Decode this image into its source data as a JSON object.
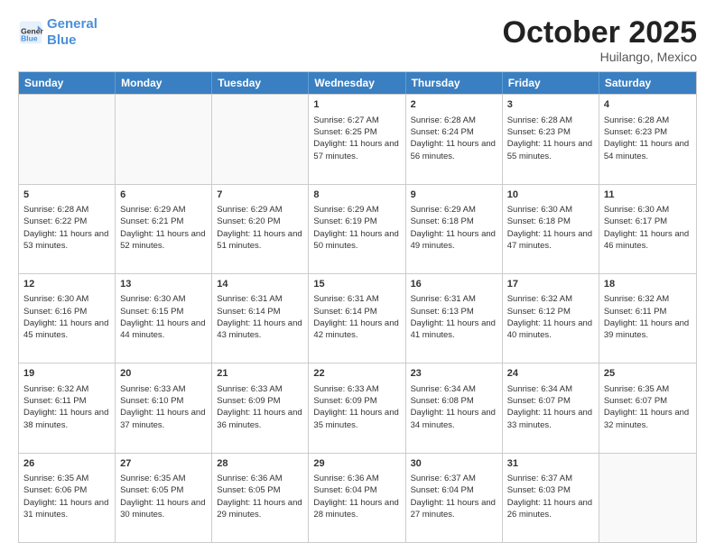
{
  "logo": {
    "line1": "General",
    "line2": "Blue"
  },
  "title": "October 2025",
  "location": "Huilango, Mexico",
  "days_of_week": [
    "Sunday",
    "Monday",
    "Tuesday",
    "Wednesday",
    "Thursday",
    "Friday",
    "Saturday"
  ],
  "weeks": [
    [
      {
        "day": "",
        "empty": true
      },
      {
        "day": "",
        "empty": true
      },
      {
        "day": "",
        "empty": true
      },
      {
        "day": "1",
        "sunrise": "6:27 AM",
        "sunset": "6:25 PM",
        "daylight": "11 hours and 57 minutes."
      },
      {
        "day": "2",
        "sunrise": "6:28 AM",
        "sunset": "6:24 PM",
        "daylight": "11 hours and 56 minutes."
      },
      {
        "day": "3",
        "sunrise": "6:28 AM",
        "sunset": "6:23 PM",
        "daylight": "11 hours and 55 minutes."
      },
      {
        "day": "4",
        "sunrise": "6:28 AM",
        "sunset": "6:23 PM",
        "daylight": "11 hours and 54 minutes."
      }
    ],
    [
      {
        "day": "5",
        "sunrise": "6:28 AM",
        "sunset": "6:22 PM",
        "daylight": "11 hours and 53 minutes."
      },
      {
        "day": "6",
        "sunrise": "6:29 AM",
        "sunset": "6:21 PM",
        "daylight": "11 hours and 52 minutes."
      },
      {
        "day": "7",
        "sunrise": "6:29 AM",
        "sunset": "6:20 PM",
        "daylight": "11 hours and 51 minutes."
      },
      {
        "day": "8",
        "sunrise": "6:29 AM",
        "sunset": "6:19 PM",
        "daylight": "11 hours and 50 minutes."
      },
      {
        "day": "9",
        "sunrise": "6:29 AM",
        "sunset": "6:18 PM",
        "daylight": "11 hours and 49 minutes."
      },
      {
        "day": "10",
        "sunrise": "6:30 AM",
        "sunset": "6:18 PM",
        "daylight": "11 hours and 47 minutes."
      },
      {
        "day": "11",
        "sunrise": "6:30 AM",
        "sunset": "6:17 PM",
        "daylight": "11 hours and 46 minutes."
      }
    ],
    [
      {
        "day": "12",
        "sunrise": "6:30 AM",
        "sunset": "6:16 PM",
        "daylight": "11 hours and 45 minutes."
      },
      {
        "day": "13",
        "sunrise": "6:30 AM",
        "sunset": "6:15 PM",
        "daylight": "11 hours and 44 minutes."
      },
      {
        "day": "14",
        "sunrise": "6:31 AM",
        "sunset": "6:14 PM",
        "daylight": "11 hours and 43 minutes."
      },
      {
        "day": "15",
        "sunrise": "6:31 AM",
        "sunset": "6:14 PM",
        "daylight": "11 hours and 42 minutes."
      },
      {
        "day": "16",
        "sunrise": "6:31 AM",
        "sunset": "6:13 PM",
        "daylight": "11 hours and 41 minutes."
      },
      {
        "day": "17",
        "sunrise": "6:32 AM",
        "sunset": "6:12 PM",
        "daylight": "11 hours and 40 minutes."
      },
      {
        "day": "18",
        "sunrise": "6:32 AM",
        "sunset": "6:11 PM",
        "daylight": "11 hours and 39 minutes."
      }
    ],
    [
      {
        "day": "19",
        "sunrise": "6:32 AM",
        "sunset": "6:11 PM",
        "daylight": "11 hours and 38 minutes."
      },
      {
        "day": "20",
        "sunrise": "6:33 AM",
        "sunset": "6:10 PM",
        "daylight": "11 hours and 37 minutes."
      },
      {
        "day": "21",
        "sunrise": "6:33 AM",
        "sunset": "6:09 PM",
        "daylight": "11 hours and 36 minutes."
      },
      {
        "day": "22",
        "sunrise": "6:33 AM",
        "sunset": "6:09 PM",
        "daylight": "11 hours and 35 minutes."
      },
      {
        "day": "23",
        "sunrise": "6:34 AM",
        "sunset": "6:08 PM",
        "daylight": "11 hours and 34 minutes."
      },
      {
        "day": "24",
        "sunrise": "6:34 AM",
        "sunset": "6:07 PM",
        "daylight": "11 hours and 33 minutes."
      },
      {
        "day": "25",
        "sunrise": "6:35 AM",
        "sunset": "6:07 PM",
        "daylight": "11 hours and 32 minutes."
      }
    ],
    [
      {
        "day": "26",
        "sunrise": "6:35 AM",
        "sunset": "6:06 PM",
        "daylight": "11 hours and 31 minutes."
      },
      {
        "day": "27",
        "sunrise": "6:35 AM",
        "sunset": "6:05 PM",
        "daylight": "11 hours and 30 minutes."
      },
      {
        "day": "28",
        "sunrise": "6:36 AM",
        "sunset": "6:05 PM",
        "daylight": "11 hours and 29 minutes."
      },
      {
        "day": "29",
        "sunrise": "6:36 AM",
        "sunset": "6:04 PM",
        "daylight": "11 hours and 28 minutes."
      },
      {
        "day": "30",
        "sunrise": "6:37 AM",
        "sunset": "6:04 PM",
        "daylight": "11 hours and 27 minutes."
      },
      {
        "day": "31",
        "sunrise": "6:37 AM",
        "sunset": "6:03 PM",
        "daylight": "11 hours and 26 minutes."
      },
      {
        "day": "",
        "empty": true
      }
    ]
  ],
  "labels": {
    "sunrise": "Sunrise:",
    "sunset": "Sunset:",
    "daylight": "Daylight:"
  }
}
